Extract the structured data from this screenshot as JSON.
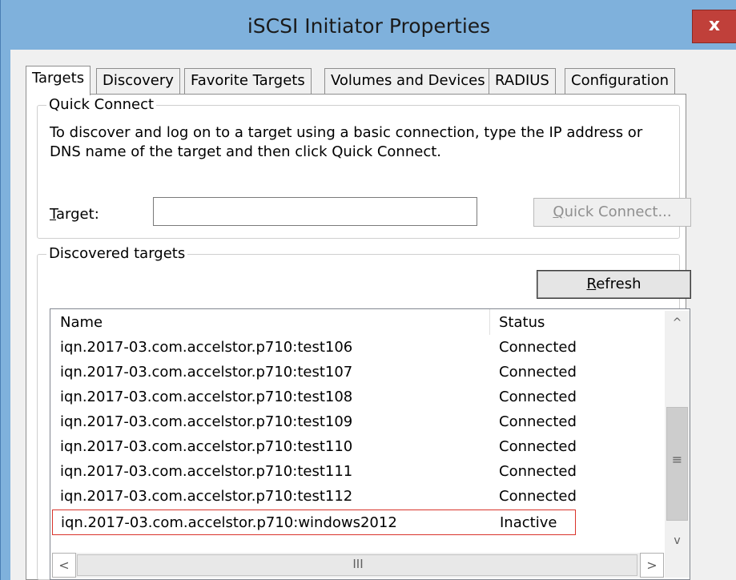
{
  "window": {
    "title": "iSCSI Initiator Properties",
    "close_label": "x"
  },
  "tabs": [
    {
      "label": "Targets",
      "active": true
    },
    {
      "label": "Discovery",
      "active": false
    },
    {
      "label": "Favorite Targets",
      "active": false
    },
    {
      "label": "Volumes and Devices",
      "active": false
    },
    {
      "label": "RADIUS",
      "active": false
    },
    {
      "label": "Configuration",
      "active": false
    }
  ],
  "quick_connect": {
    "legend": "Quick Connect",
    "description_line1": "To discover and log on to a target using a basic connection, type the IP address or",
    "description_line2": "DNS name of the target and then click Quick Connect.",
    "target_label_mnemonic": "T",
    "target_label_rest": "arget:",
    "target_value": "",
    "button_pre": "Q",
    "button_rest": "uick Connect..."
  },
  "discovered": {
    "legend_pre": "Discovered tar",
    "legend_mnemonic": "g",
    "legend_post": "ets",
    "refresh_mnemonic": "R",
    "refresh_rest": "efresh",
    "columns": [
      "Name",
      "Status"
    ],
    "rows": [
      {
        "name": "iqn.2017-03.com.accelstor.p710:test106",
        "status": "Connected"
      },
      {
        "name": "iqn.2017-03.com.accelstor.p710:test107",
        "status": "Connected"
      },
      {
        "name": "iqn.2017-03.com.accelstor.p710:test108",
        "status": "Connected"
      },
      {
        "name": "iqn.2017-03.com.accelstor.p710:test109",
        "status": "Connected"
      },
      {
        "name": "iqn.2017-03.com.accelstor.p710:test110",
        "status": "Connected"
      },
      {
        "name": "iqn.2017-03.com.accelstor.p710:test111",
        "status": "Connected"
      },
      {
        "name": "iqn.2017-03.com.accelstor.p710:test112",
        "status": "Connected"
      },
      {
        "name": "iqn.2017-03.com.accelstor.p710:windows2012",
        "status": "Inactive"
      }
    ],
    "scroll": {
      "up": "^",
      "down": "v",
      "left": "<",
      "right": ">",
      "vgrip": "≡",
      "hgrip": "III"
    }
  },
  "colors": {
    "title_bar": "#7fb1dc",
    "close_button": "#c0403a",
    "highlight_border": "#d9342b"
  },
  "icons": [
    "close-icon",
    "scroll-up-icon",
    "scroll-down-icon",
    "scroll-left-icon",
    "scroll-right-icon"
  ]
}
